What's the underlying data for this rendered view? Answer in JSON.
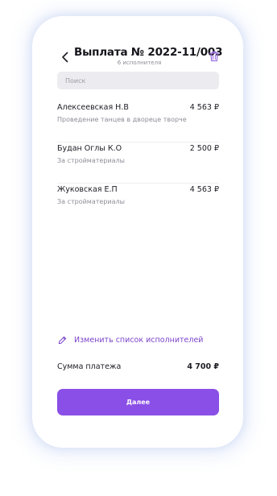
{
  "header": {
    "title": "Выплата № 2022-11/003",
    "subtitle": "6 исполнителя"
  },
  "search": {
    "placeholder": "Поиск",
    "value": ""
  },
  "executors": [
    {
      "name": "Алексеевская Н.В",
      "amount": "4 563 ₽",
      "description": "Проведение танцев в двореце творче"
    },
    {
      "name": "Будан Оглы К.О",
      "amount": "2 500 ₽",
      "description": "За стройматериалы"
    },
    {
      "name": "Жуковская Е.П",
      "amount": "4 563 ₽",
      "description": "За стройматериалы"
    }
  ],
  "edit_list": {
    "label": "Изменить список исполнителей"
  },
  "summary": {
    "label": "Сумма платежа",
    "value": "4 700 ₽"
  },
  "actions": {
    "next_label": "Далее"
  },
  "icons": {
    "back": "chevron-left-icon",
    "trash": "trash-icon",
    "edit": "pencil-icon"
  },
  "colors": {
    "accent": "#8a4fe6",
    "link": "#7b44c9",
    "trash": "#9b6ee0",
    "muted_text": "#8e8e98",
    "search_bg": "#ececf0"
  }
}
